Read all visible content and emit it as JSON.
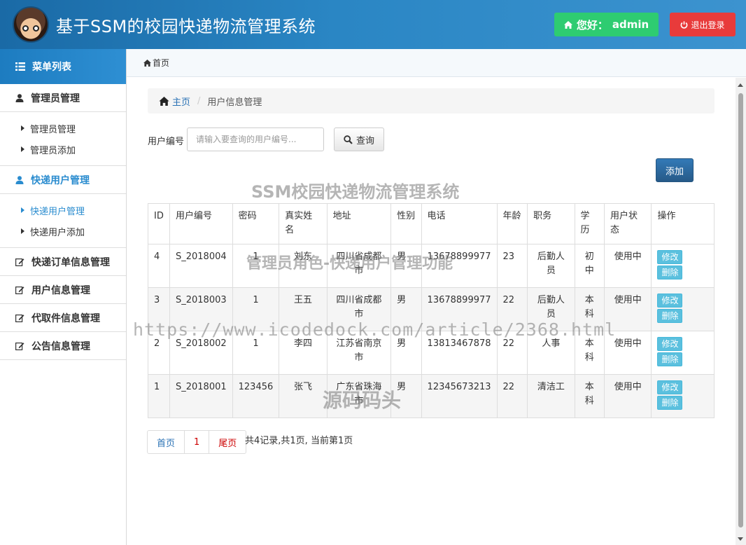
{
  "header": {
    "title": "基于SSM的校园快递物流管理系统",
    "greeting": "您好：",
    "username": "admin",
    "logout_label": "退出登录"
  },
  "sidebar": {
    "menu_title": "菜单列表",
    "groups": [
      {
        "label": "管理员管理",
        "items": [
          "管理员管理",
          "管理员添加"
        ]
      },
      {
        "label": "快递用户管理",
        "items": [
          "快递用户管理",
          "快递用户添加"
        ]
      },
      {
        "label": "快递订单信息管理"
      },
      {
        "label": "用户信息管理"
      },
      {
        "label": "代取件信息管理"
      },
      {
        "label": "公告信息管理"
      }
    ]
  },
  "topbar": {
    "home_label": "首页"
  },
  "breadcrumb": {
    "home": "主页",
    "current": "用户信息管理"
  },
  "search": {
    "label": "用户编号",
    "placeholder": "请输入要查询的用户编号...",
    "button_label": "查询"
  },
  "add_label": "添加",
  "table": {
    "headers": [
      "ID",
      "用户编号",
      "密码",
      "真实姓名",
      "地址",
      "性别",
      "电话",
      "年龄",
      "职务",
      "学历",
      "用户状态",
      "操作"
    ],
    "rows": [
      {
        "id": "4",
        "user_no": "S_2018004",
        "password": "1",
        "name": "刘东",
        "address": "四川省成都市",
        "gender": "男",
        "phone": "13678899977",
        "age": "23",
        "job": "后勤人员",
        "education": "初中",
        "status": "使用中"
      },
      {
        "id": "3",
        "user_no": "S_2018003",
        "password": "1",
        "name": "王五",
        "address": "四川省成都市",
        "gender": "男",
        "phone": "13678899977",
        "age": "22",
        "job": "后勤人员",
        "education": "本科",
        "status": "使用中"
      },
      {
        "id": "2",
        "user_no": "S_2018002",
        "password": "1",
        "name": "李四",
        "address": "江苏省南京市",
        "gender": "男",
        "phone": "13813467878",
        "age": "22",
        "job": "人事",
        "education": "本科",
        "status": "使用中"
      },
      {
        "id": "1",
        "user_no": "S_2018001",
        "password": "123456",
        "name": "张飞",
        "address": "广东省珠海市",
        "gender": "男",
        "phone": "12345673213",
        "age": "22",
        "job": "清洁工",
        "education": "本科",
        "status": "使用中"
      }
    ],
    "edit_label": "修改",
    "delete_label": "删除"
  },
  "pagination": {
    "first": "首页",
    "current_page": "1",
    "last": "尾页",
    "info": "共4记录,共1页, 当前第1页"
  },
  "watermarks": [
    "SSM校园快递物流管理系统",
    "管理员角色-快递用户管理功能",
    "https://www.icodedock.com/article/2368.html",
    "源码码头"
  ],
  "colors": {
    "header_start": "#1a6aa6",
    "greet_button": "#2ecc71",
    "logout_button": "#e83b3b",
    "active_menu": "#2a8ccf",
    "add_button": "#337ab7",
    "op_button": "#5bc0de"
  }
}
